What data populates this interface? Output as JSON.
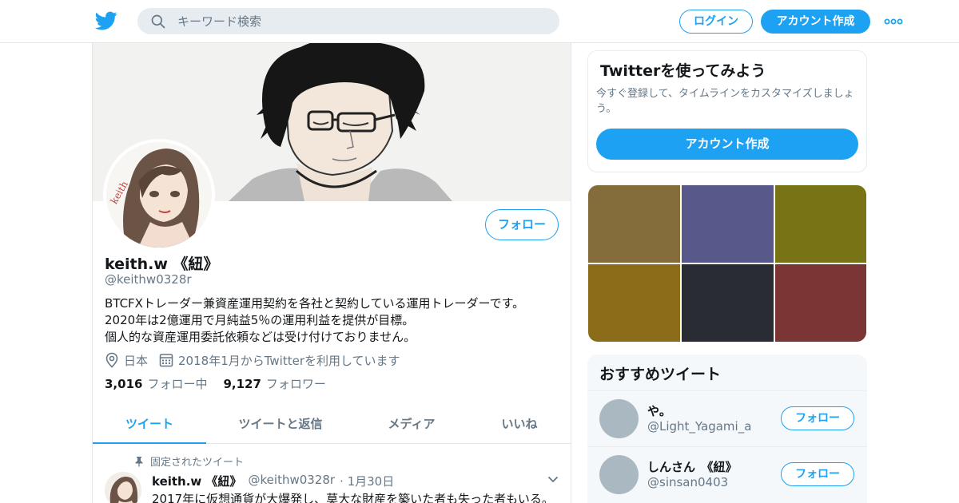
{
  "header": {
    "logo_icon": "twitter-bird-icon",
    "search_placeholder": "キーワード検索",
    "login_label": "ログイン",
    "signup_label": "アカウント作成",
    "more_icon": "more-dots-icon",
    "accent_color": "#1da1f2"
  },
  "profile": {
    "name": "keith.w 《紐》",
    "handle": "@keithw0328r",
    "follow_label": "フォロー",
    "bio_lines": [
      "BTCFXトレーダー兼資産運用契約を各社と契約している運用トレーダーです。",
      "2020年は2億運用で月純益5％の運用利益を提供が目標。",
      "個人的な資産運用委託依頼などは受け付けておりません。"
    ],
    "location": "日本",
    "joined": "2018年1月からTwitterを利用しています",
    "following_count": "3,016",
    "following_label": "フォロー中",
    "followers_count": "9,127",
    "followers_label": "フォロワー"
  },
  "tabs": [
    {
      "label": "ツイート",
      "active": true
    },
    {
      "label": "ツイートと返信",
      "active": false
    },
    {
      "label": "メディア",
      "active": false
    },
    {
      "label": "いいね",
      "active": false
    }
  ],
  "pinned_tweet": {
    "pinned_label": "固定されたツイート",
    "author_name": "keith.w 《紐》",
    "author_handle": "@keithw0328r",
    "date": "· 1月30日",
    "text": "2017年に仮想通貨が大爆発し、莫大な財産を築いた者も失った者もいる。"
  },
  "signup_card": {
    "title": "Twitterを使ってみよう",
    "description": "今すぐ登録して、タイムラインをカスタマイズしましょう。",
    "button_label": "アカウント作成"
  },
  "media_tiles": [
    {
      "color": "#846c3b"
    },
    {
      "color": "#58588a"
    },
    {
      "color": "#787315"
    },
    {
      "color": "#8a6c19"
    },
    {
      "color": "#292c33"
    },
    {
      "color": "#7a3534"
    }
  ],
  "recommended": {
    "title": "おすすめツイート",
    "items": [
      {
        "name": "や。",
        "handle": "@Light_Yagami_a",
        "button_label": "フォロー"
      },
      {
        "name": "しんさん　《紐》",
        "handle": "@sinsan0403",
        "button_label": "フォロー"
      }
    ]
  }
}
